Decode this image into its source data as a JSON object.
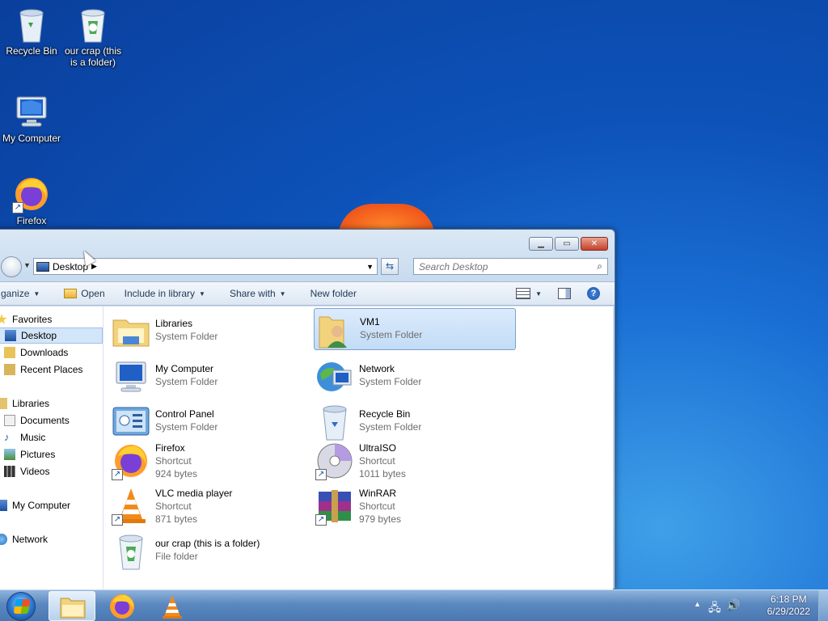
{
  "desktop": {
    "icons": [
      {
        "label": "Recycle Bin",
        "icon": "recycle-bin-icon"
      },
      {
        "label": "our crap (this is a folder)",
        "icon": "recycle-bin-full-icon"
      },
      {
        "label": "My Computer",
        "icon": "computer-icon"
      },
      {
        "label": "Firefox",
        "icon": "firefox-icon"
      }
    ]
  },
  "window": {
    "address": {
      "location": "Desktop"
    },
    "search": {
      "placeholder": "Search Desktop"
    },
    "toolbar": {
      "organize": "ganize",
      "open": "Open",
      "include_in_library": "Include in library",
      "share_with": "Share with",
      "new_folder": "New folder"
    },
    "nav": {
      "favorites": "Favorites",
      "desktop": "Desktop",
      "downloads": "Downloads",
      "recent_places": "Recent Places",
      "libraries": "Libraries",
      "documents": "Documents",
      "music": "Music",
      "pictures": "Pictures",
      "videos": "Videos",
      "my_computer": "My Computer",
      "network": "Network"
    },
    "files": [
      {
        "name": "Libraries",
        "type": "System Folder",
        "size": ""
      },
      {
        "name": "VM1",
        "type": "System Folder",
        "size": ""
      },
      {
        "name": "My Computer",
        "type": "System Folder",
        "size": ""
      },
      {
        "name": "Network",
        "type": "System Folder",
        "size": ""
      },
      {
        "name": "Control Panel",
        "type": "System Folder",
        "size": ""
      },
      {
        "name": "Recycle Bin",
        "type": "System Folder",
        "size": ""
      },
      {
        "name": "Firefox",
        "type": "Shortcut",
        "size": "924 bytes"
      },
      {
        "name": "UltraISO",
        "type": "Shortcut",
        "size": "1011 bytes"
      },
      {
        "name": "VLC media player",
        "type": "Shortcut",
        "size": "871 bytes"
      },
      {
        "name": "WinRAR",
        "type": "Shortcut",
        "size": "979 bytes"
      },
      {
        "name": "our crap (this is a folder)",
        "type": "File folder",
        "size": ""
      }
    ],
    "selected_file": "VM1"
  },
  "taskbar": {
    "clock_time": "6:18 PM",
    "clock_date": "6/29/2022"
  },
  "colors": {
    "desktop_blue": "#0d52b8",
    "selection": "#c2dcf6",
    "taskbar": "#5b88bf"
  }
}
